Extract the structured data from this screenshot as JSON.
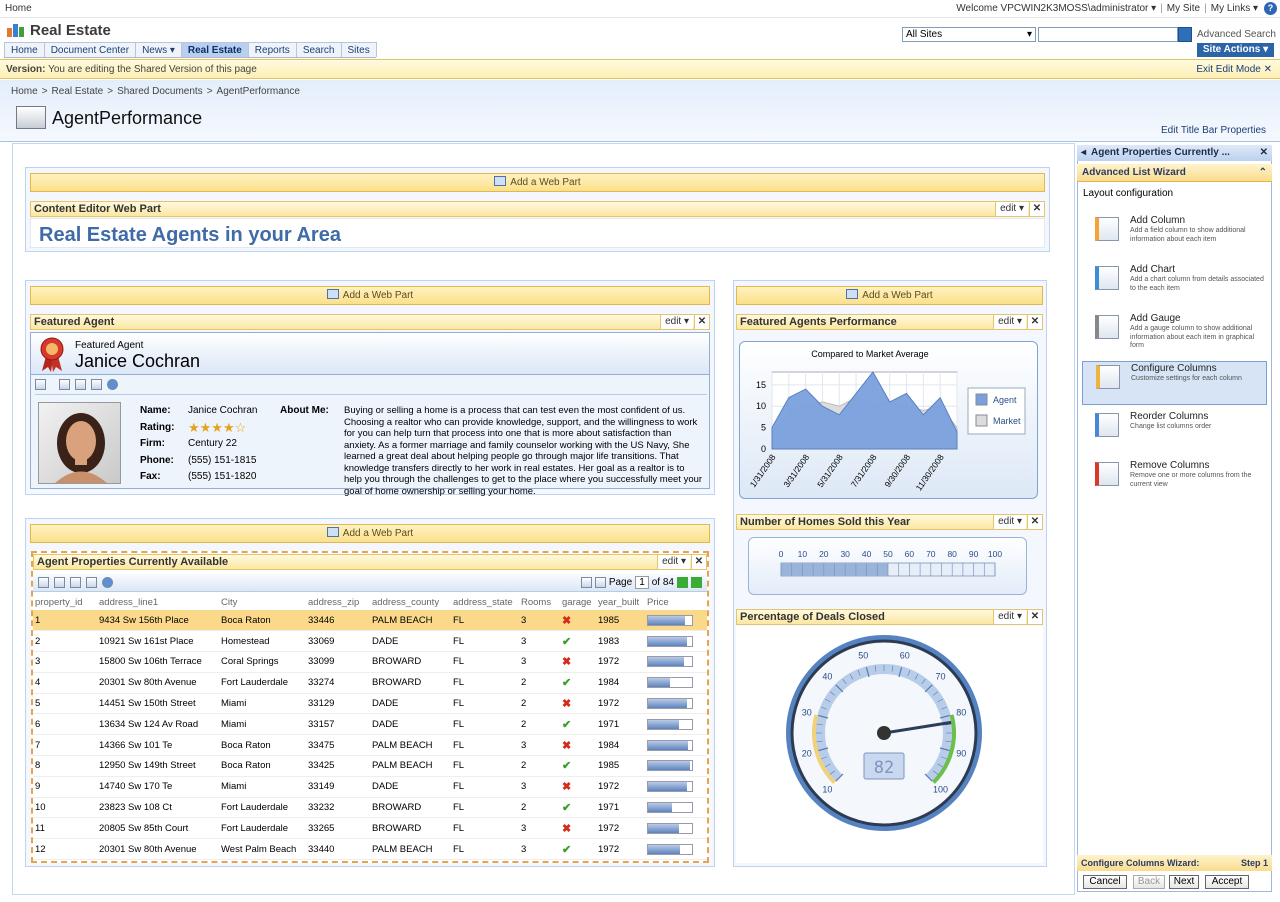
{
  "topbar": {
    "home": "Home",
    "welcome": "Welcome VPCWIN2K3MOSS\\administrator ▾",
    "mysite": "My Site",
    "mylinks": "My Links ▾",
    "sep": "|"
  },
  "site": {
    "title": "Real Estate",
    "scope": "All Sites",
    "advanced_search": "Advanced Search",
    "site_actions": "Site Actions ▾"
  },
  "nav": [
    {
      "label": "Home"
    },
    {
      "label": "Document Center"
    },
    {
      "label": "News ▾"
    },
    {
      "label": "Real Estate"
    },
    {
      "label": "Reports"
    },
    {
      "label": "Search"
    },
    {
      "label": "Sites"
    }
  ],
  "version": {
    "label": "Version:",
    "text": "You are editing the Shared Version of this page",
    "exit": "Exit Edit Mode ✕"
  },
  "breadcrumb": [
    "Home",
    ">",
    "Real Estate",
    ">",
    "Shared Documents",
    ">",
    "AgentPerformance"
  ],
  "page": {
    "title": "AgentPerformance",
    "title_props": "Edit Title Bar Properties"
  },
  "add_web_part": "Add a Web Part",
  "wp_edit": "edit ▾",
  "wp_close": "✕",
  "content_editor": {
    "title": "Content Editor Web Part",
    "heading": "Real Estate Agents in your Area"
  },
  "featured": {
    "title": "Featured Agent",
    "sub": "Featured Agent",
    "name": "Janice Cochran",
    "fields": [
      {
        "k": "Name:",
        "v": "Janice Cochran"
      },
      {
        "k": "Rating:",
        "v": "★★★★☆"
      },
      {
        "k": "Firm:",
        "v": "Century 22"
      },
      {
        "k": "Phone:",
        "v": "(555) 151-1815"
      },
      {
        "k": "Fax:",
        "v": "(555) 151-1820"
      }
    ],
    "about_label": "About Me:",
    "about": "Buying or selling a home is a process that can test even the most confident of us. Choosing a realtor who can provide knowledge, support, and the willingness to work for you can help turn that process into one that is more about satisfaction than anxiety. As a former marriage and family counselor working with the US Navy, She learned a great deal about helping people go through major life transitions. That knowledge transfers directly to her work in real estates. Her goal as a realtor is to help you through the challenges to get to the place where you successfully meet your goal of home ownership or selling your home."
  },
  "performance": {
    "title": "Featured Agents Performance"
  },
  "chart_data": [
    {
      "type": "area",
      "title": "Compared to Market Average",
      "x": [
        "1/31/2008",
        "2/29/2008",
        "3/31/2008",
        "4/30/2008",
        "5/31/2008",
        "6/30/2008",
        "7/31/2008",
        "8/31/2008",
        "9/30/2008",
        "10/31/2008",
        "11/30/2008",
        "12/31/2008"
      ],
      "series": [
        {
          "name": "Agent",
          "values": [
            5,
            12,
            14,
            10,
            8,
            13,
            18,
            11,
            13,
            8,
            12,
            4
          ]
        },
        {
          "name": "Market",
          "values": [
            4,
            8,
            10,
            11,
            10,
            12,
            10,
            11,
            10,
            9,
            10,
            5
          ]
        }
      ],
      "ylim": [
        0,
        18
      ],
      "yticks": [
        0,
        5,
        10,
        15
      ],
      "xticks": [
        "1/31/2008",
        "3/31/2008",
        "5/31/2008",
        "7/31/2008",
        "9/30/2008",
        "11/30/2008"
      ],
      "legend": "right"
    },
    {
      "type": "gauge",
      "title": "Number of Homes Sold this Year",
      "ticks": [
        0,
        10,
        20,
        30,
        40,
        50,
        60,
        70,
        80,
        90,
        100
      ],
      "value": 50
    },
    {
      "type": "gauge",
      "title": "Percentage of Deals Closed",
      "ticks": [
        10,
        20,
        30,
        40,
        50,
        60,
        70,
        80,
        90,
        100
      ],
      "value": 82
    }
  ],
  "homes_sold": {
    "title": "Number of Homes Sold this Year"
  },
  "deals": {
    "title": "Percentage of Deals Closed",
    "display": "82"
  },
  "properties": {
    "title": "Agent Properties Currently Available",
    "page_label": "Page",
    "page": "1",
    "of": "of 84",
    "columns": [
      "property_id",
      "address_line1",
      "City",
      "address_zip",
      "address_county",
      "address_state",
      "Rooms",
      "garage",
      "year_built",
      "Price"
    ],
    "rows": [
      [
        "1",
        "9434 Sw 156th Place",
        "Boca Raton",
        "33446",
        "PALM BEACH",
        "FL",
        "3",
        "no",
        "1985",
        0.85
      ],
      [
        "2",
        "10921 Sw 161st Place",
        "Homestead",
        "33069",
        "DADE",
        "FL",
        "3",
        "yes",
        "1983",
        0.88
      ],
      [
        "3",
        "15800 Sw 106th Terrace",
        "Coral Springs",
        "33099",
        "BROWARD",
        "FL",
        "3",
        "no",
        "1972",
        0.82
      ],
      [
        "4",
        "20301 Sw 80th Avenue",
        "Fort Lauderdale",
        "33274",
        "BROWARD",
        "FL",
        "2",
        "yes",
        "1984",
        0.5
      ],
      [
        "5",
        "14451 Sw 150th Street",
        "Miami",
        "33129",
        "DADE",
        "FL",
        "2",
        "no",
        "1972",
        0.88
      ],
      [
        "6",
        "13634 Sw 124 Av Road",
        "Miami",
        "33157",
        "DADE",
        "FL",
        "2",
        "yes",
        "1971",
        0.7
      ],
      [
        "7",
        "14366 Sw 101 Te",
        "Boca Raton",
        "33475",
        "PALM BEACH",
        "FL",
        "3",
        "no",
        "1984",
        0.9
      ],
      [
        "8",
        "12950 Sw 149th Street",
        "Boca Raton",
        "33425",
        "PALM BEACH",
        "FL",
        "2",
        "yes",
        "1985",
        0.95
      ],
      [
        "9",
        "14740 Sw 170 Te",
        "Miami",
        "33149",
        "DADE",
        "FL",
        "3",
        "no",
        "1972",
        0.88
      ],
      [
        "10",
        "23823 Sw 108 Ct",
        "Fort Lauderdale",
        "33232",
        "BROWARD",
        "FL",
        "2",
        "yes",
        "1971",
        0.55
      ],
      [
        "11",
        "20805 Sw 85th Court",
        "Fort Lauderdale",
        "33265",
        "BROWARD",
        "FL",
        "3",
        "no",
        "1972",
        0.7
      ],
      [
        "12",
        "20301 Sw 80th Avenue",
        "West Palm Beach",
        "33440",
        "PALM BEACH",
        "FL",
        "3",
        "yes",
        "1972",
        0.72
      ]
    ]
  },
  "pane": {
    "title": "Agent Properties Currently ...",
    "wizard": "Advanced List Wizard",
    "layout": "Layout configuration",
    "tasks": [
      {
        "t": "Add Column",
        "d": "Add a field column to show additional information about each item"
      },
      {
        "t": "Add Chart",
        "d": "Add a chart column from details associated to the each item"
      },
      {
        "t": "Add Gauge",
        "d": "Add a gauge column to show additional information about each item in graphical form"
      },
      {
        "t": "Configure Columns",
        "d": "Customize settings for each column"
      },
      {
        "t": "Reorder Columns",
        "d": "Change list columns order"
      },
      {
        "t": "Remove Columns",
        "d": "Remove one or more columns from the current view"
      }
    ],
    "footer": "Configure Columns Wizard:",
    "step": "Step 1",
    "buttons": {
      "cancel": "Cancel",
      "back": "Back",
      "next": "Next",
      "accept": "Accept"
    }
  }
}
